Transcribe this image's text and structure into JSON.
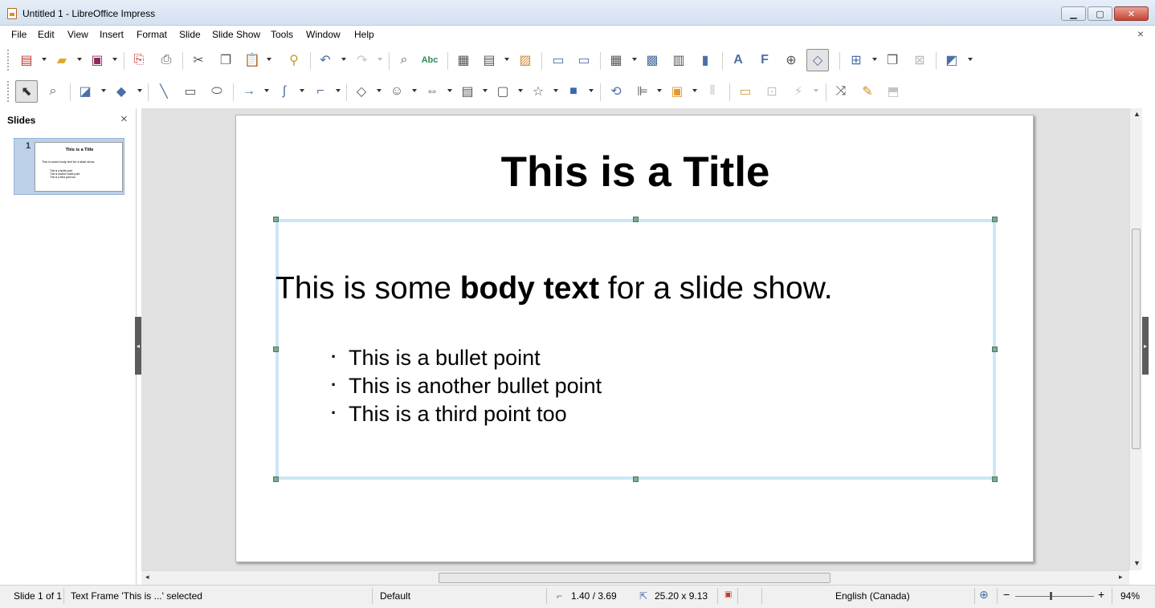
{
  "window": {
    "title": "Untitled 1 - LibreOffice Impress",
    "controls": {
      "minimize": "▁",
      "maximize": "▢",
      "close": "✕"
    }
  },
  "menubar": {
    "items": [
      "File",
      "Edit",
      "View",
      "Insert",
      "Format",
      "Slide",
      "Slide Show",
      "Tools",
      "Window",
      "Help"
    ],
    "doc_close": "×"
  },
  "slides_pane": {
    "header": "Slides",
    "close": "×",
    "thumbnails": [
      {
        "number": "1",
        "title": "This is a Title",
        "body": "This is some body text for a slide show.",
        "bullets": [
          "This is a bullet point",
          "This is another bullet point",
          "This is a third point too"
        ]
      }
    ]
  },
  "slide": {
    "title": "This is a Title",
    "body_prefix": "This is some ",
    "body_bold": "body text",
    "body_suffix": " for a slide show.",
    "bullets": [
      "This is a bullet point",
      "This is another bullet point",
      "This is a third point too"
    ]
  },
  "statusbar": {
    "slide_info": "Slide 1 of 1",
    "selection": "Text Frame 'This is ...' selected",
    "layout": "Default",
    "position": "1.40 / 3.69",
    "size": "25.20 x 9.13",
    "language": "English (Canada)",
    "zoom_out": "−",
    "zoom_in": "+",
    "zoom": "94%"
  },
  "colors": {
    "accent": "#4b6fa6",
    "frame_border": "#cce6f7",
    "handle": "#7eab90",
    "workspace_bg": "#e1e1e1"
  },
  "icons": {
    "toolbar1": [
      "new-icon",
      "open-icon",
      "save-icon",
      "export-pdf-icon",
      "print-icon",
      "cut-icon",
      "copy-icon",
      "paste-icon",
      "clone-formatting-icon",
      "undo-icon",
      "redo-icon",
      "find-replace-icon",
      "spelling-icon",
      "grid-icon",
      "display-views-icon",
      "image-icon",
      "start-presentation-icon",
      "start-from-current-icon",
      "table-icon",
      "insert-image-icon",
      "media-icon",
      "chart-icon",
      "textbox-icon",
      "fontwork-icon",
      "hyperlink-icon",
      "shapes-icon",
      "insert-slide-icon",
      "duplicate-slide-icon",
      "delete-slide-icon",
      "slide-layout-icon"
    ],
    "toolbar2": [
      "select-icon",
      "zoom-icon",
      "line-color-icon",
      "fill-color-icon",
      "line-icon",
      "rectangle-icon",
      "ellipse-icon",
      "arrow-icon",
      "curve-icon",
      "connector-icon",
      "basic-shapes-icon",
      "symbol-shapes-icon",
      "block-arrows-icon",
      "flowchart-icon",
      "callout-icon",
      "stars-icon",
      "3d-objects-icon",
      "transform-icon",
      "align-icon",
      "arrange-icon",
      "distribute-icon",
      "shadow-icon",
      "crop-icon",
      "filter-icon",
      "points-icon",
      "glue-points-icon",
      "extrusion-icon"
    ]
  }
}
